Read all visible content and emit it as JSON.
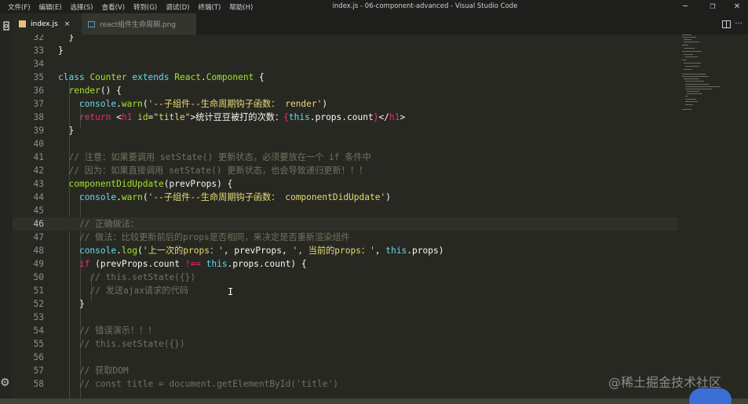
{
  "menu": [
    "文件(F)",
    "编辑(E)",
    "选择(S)",
    "查看(V)",
    "转到(G)",
    "调试(D)",
    "终端(T)",
    "帮助(H)"
  ],
  "window_title": "index.js - 06-component-advanced - Visual Studio Code",
  "window_controls": {
    "minimize": "─",
    "restore": "❐",
    "close": "✕"
  },
  "tabs": [
    {
      "label": "index.js",
      "active": true,
      "close": "×"
    },
    {
      "label": "react组件生命周期.png",
      "active": false
    }
  ],
  "editor": {
    "current_line": 46,
    "lines": [
      {
        "n": "32",
        "text": "  }"
      },
      {
        "n": "33",
        "text": "}"
      },
      {
        "n": "34",
        "text": ""
      },
      {
        "n": "35",
        "text": "class Counter extends React.Component {"
      },
      {
        "n": "36",
        "text": "  render() {"
      },
      {
        "n": "37",
        "text": "    console.warn('--子组件--生命周期钩子函数： render')"
      },
      {
        "n": "38",
        "text": "    return <h1 id=\"title\">统计豆豆被打的次数：{this.props.count}</h1>"
      },
      {
        "n": "39",
        "text": "  }"
      },
      {
        "n": "40",
        "text": ""
      },
      {
        "n": "41",
        "text": "  // 注意：如果要调用 setState() 更新状态，必须要放在一个 if 条件中"
      },
      {
        "n": "42",
        "text": "  // 因为：如果直接调用 setState() 更新状态，也会导致递归更新！！！"
      },
      {
        "n": "43",
        "text": "  componentDidUpdate(prevProps) {"
      },
      {
        "n": "44",
        "text": "    console.warn('--子组件--生命周期钩子函数： componentDidUpdate')"
      },
      {
        "n": "45",
        "text": ""
      },
      {
        "n": "46",
        "text": "    // 正确做法："
      },
      {
        "n": "47",
        "text": "    // 做法：比较更新前后的props是否相同，来决定是否重新渲染组件"
      },
      {
        "n": "48",
        "text": "    console.log('上一次的props：', prevProps, ', 当前的props：', this.props)"
      },
      {
        "n": "49",
        "text": "    if (prevProps.count !== this.props.count) {"
      },
      {
        "n": "50",
        "text": "      // this.setState({})"
      },
      {
        "n": "51",
        "text": "      // 发送ajax请求的代码"
      },
      {
        "n": "52",
        "text": "    }"
      },
      {
        "n": "53",
        "text": ""
      },
      {
        "n": "54",
        "text": "    // 错误演示！！！"
      },
      {
        "n": "55",
        "text": "    // this.setState({})"
      },
      {
        "n": "56",
        "text": ""
      },
      {
        "n": "57",
        "text": "    // 获取DOM"
      },
      {
        "n": "58",
        "text": "    // const title = document.getElementById('title')"
      }
    ]
  },
  "watermark": "@稀土掘金技术社区",
  "colors": {
    "background": "#272822",
    "keyword": "#66d9ef",
    "operator": "#f92672",
    "function": "#a6e22e",
    "string": "#e6db74",
    "comment": "#75715e",
    "statusbar": "#414339"
  }
}
